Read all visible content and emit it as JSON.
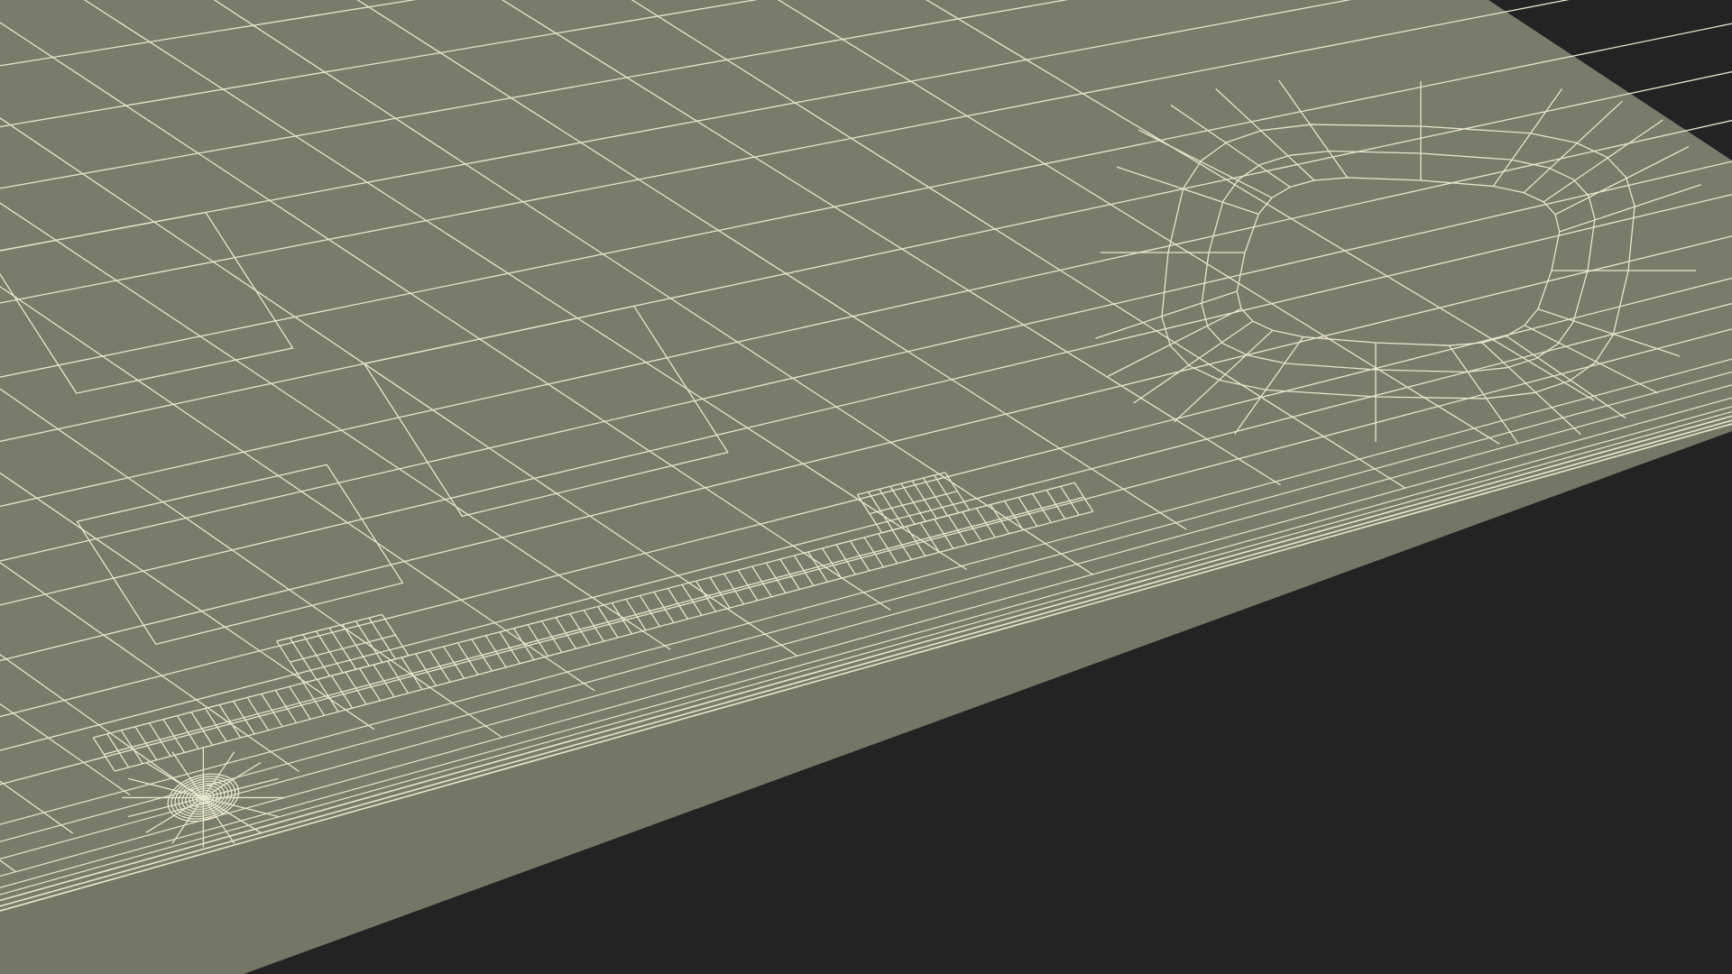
{
  "scene": {
    "subject": "wireframe-3d-panel-edge",
    "colors": {
      "background": "#232323",
      "surface": "#797b6b",
      "wire": "#e8e6cc"
    }
  }
}
